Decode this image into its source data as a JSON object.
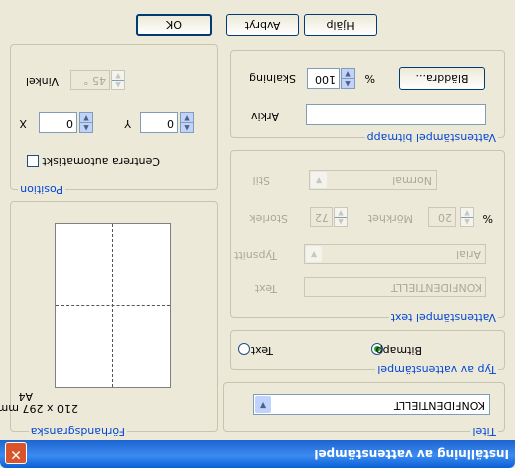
{
  "window": {
    "title": "Inställning av vattenstämpel",
    "close_glyph": "✕"
  },
  "watermark_text_select": {
    "legend": "Titel",
    "selected": "KONFIDENTIELLT"
  },
  "type": {
    "legend": "Typ av vattenstämpel",
    "text_option": "Text",
    "bitmap_option": "Bitmapp",
    "selected": "bitmap"
  },
  "text_group": {
    "legend": "Vattenstämpel text",
    "text_label": "Text",
    "text_value": "KONFIDENTIELLT",
    "font_label": "Typsnitt",
    "font_value": "Arial",
    "size_label": "Storlek",
    "size_value": "72",
    "darkness_label": "Mörkhet",
    "darkness_value": "20",
    "darkness_unit": "%",
    "style_label": "Stil",
    "style_value": "Normal"
  },
  "bitmap_group": {
    "legend": "Vattenstämpel bitmapp",
    "file_label": "Arkiv",
    "file_value": "",
    "scale_label": "Skalning",
    "scale_value": "100",
    "scale_unit": "%",
    "browse_button": "Bläddra..."
  },
  "preview": {
    "legend": "Förhandsgranska",
    "paper_name": "A4",
    "paper_size": "210 x 297 mm"
  },
  "position": {
    "legend": "Position",
    "center_label": "Centrera automatiskt",
    "center_checked": false,
    "x_label": "X",
    "x_value": "0",
    "y_label": "Y",
    "y_value": "0",
    "angle_label": "Vinkel",
    "angle_value": "45 °"
  },
  "buttons": {
    "ok": "OK",
    "cancel": "Avbryt",
    "help": "Hjälp"
  }
}
